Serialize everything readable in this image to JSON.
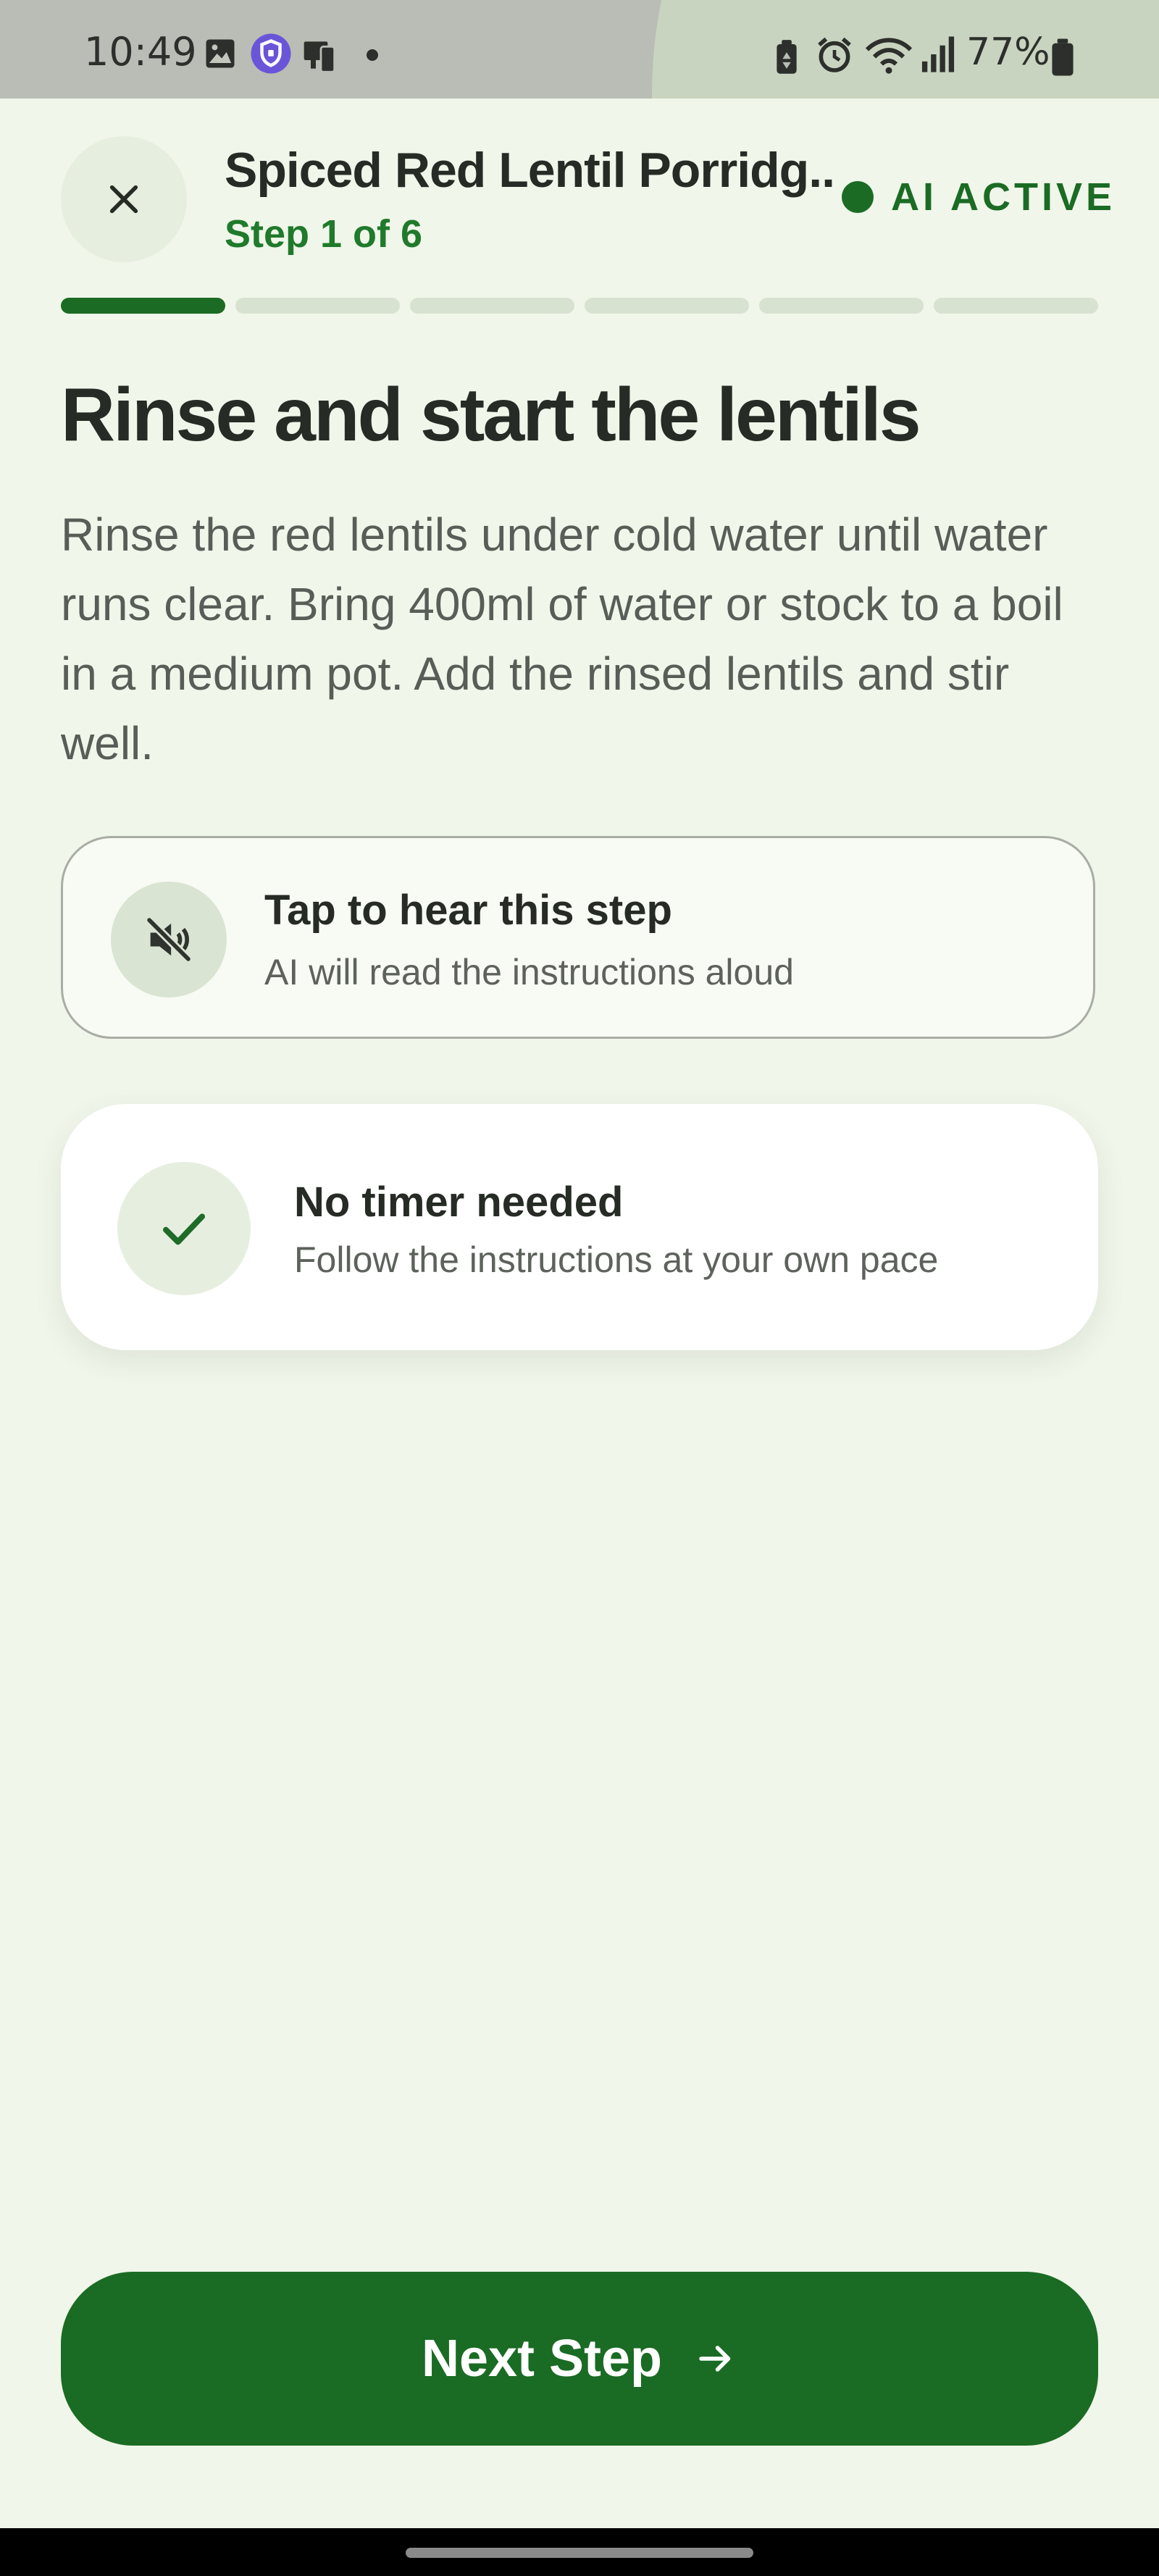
{
  "status_bar": {
    "time": "10:49",
    "battery_percent": "77%",
    "left_icons": [
      "gallery-icon",
      "vpn-shield-icon",
      "phone-link-icon",
      "dot-icon"
    ],
    "right_icons": [
      "battery-saver-icon",
      "alarm-icon",
      "wifi-icon",
      "signal-icon",
      "battery-icon"
    ]
  },
  "header": {
    "recipe_title": "Spiced Red Lentil Porridg...",
    "step_label": "Step 1 of 6",
    "ai_status": "AI ACTIVE",
    "close_icon": "close-icon"
  },
  "progress": {
    "current_step": 1,
    "total_steps": 6
  },
  "step": {
    "title": "Rinse and start the lentils",
    "instructions": "Rinse the red lentils under cold water until water runs clear. Bring 400ml of water or stock to a boil in a medium pot. Add the rinsed lentils and stir well."
  },
  "audio_card": {
    "title": "Tap to hear this step",
    "subtitle": "AI will read the instructions aloud",
    "icon": "volume-muted-icon"
  },
  "timer_card": {
    "title": "No timer needed",
    "subtitle": "Follow the instructions at your own pace",
    "icon": "check-icon"
  },
  "next_button": {
    "label": "Next Step",
    "icon": "arrow-right-icon"
  },
  "colors": {
    "background": "#f0f6ea",
    "accent_green": "#1b6b24",
    "step_label_green": "#1f7a2b",
    "progress_inactive": "#d7e3d0"
  }
}
